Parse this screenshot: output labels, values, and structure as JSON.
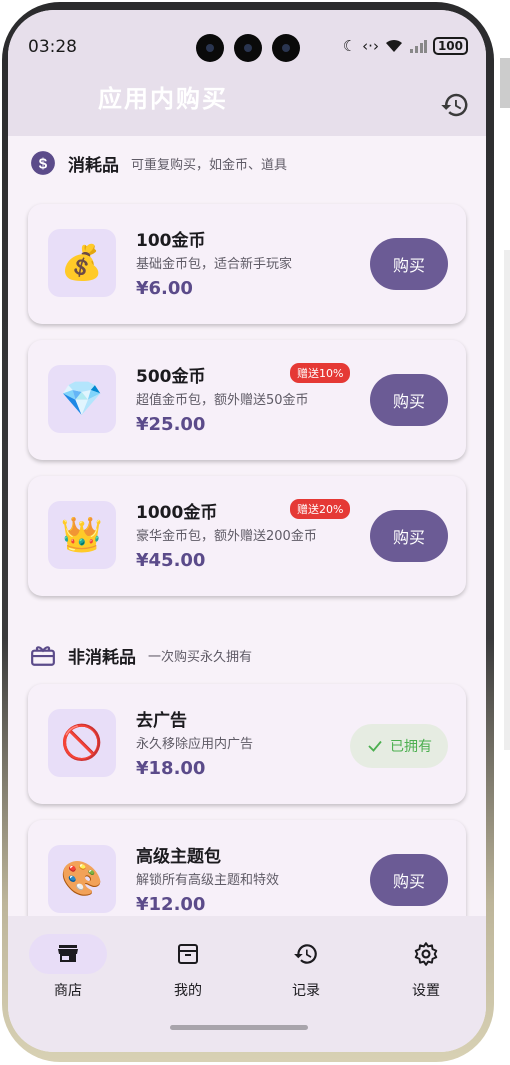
{
  "statusbar": {
    "time": "03:28",
    "battery": "100"
  },
  "appbar": {
    "title": "应用内购买"
  },
  "sections": {
    "consumable": {
      "title": "消耗品",
      "subtitle": "可重复购买，如金币、道具"
    },
    "nonconsumable": {
      "title": "非消耗品",
      "subtitle": "一次购买永久拥有"
    }
  },
  "products": [
    {
      "name": "100金币",
      "desc": "基础金币包，适合新手玩家",
      "price": "¥6.00",
      "emoji": "💰",
      "action": "购买"
    },
    {
      "name": "500金币",
      "desc": "超值金币包，额外赠送50金币",
      "price": "¥25.00",
      "emoji": "💎",
      "badge": "赠送10%",
      "action": "购买"
    },
    {
      "name": "1000金币",
      "desc": "豪华金币包，额外赠送200金币",
      "price": "¥45.00",
      "emoji": "👑",
      "badge": "赠送20%",
      "action": "购买"
    },
    {
      "name": "去广告",
      "desc": "永久移除应用内广告",
      "price": "¥18.00",
      "emoji": "🚫",
      "action": "已拥有"
    },
    {
      "name": "高级主题包",
      "desc": "解锁所有高级主题和特效",
      "price": "¥12.00",
      "emoji": "🎨",
      "action": "购买"
    }
  ],
  "nav": [
    {
      "label": "商店",
      "icon": "store-icon"
    },
    {
      "label": "我的",
      "icon": "inventory-icon"
    },
    {
      "label": "记录",
      "icon": "history-icon"
    },
    {
      "label": "设置",
      "icon": "settings-icon"
    }
  ],
  "colors": {
    "primary": "#6b5b95",
    "badge": "#e53935",
    "owned": "#4caf50",
    "background": "#f8f2f9"
  }
}
